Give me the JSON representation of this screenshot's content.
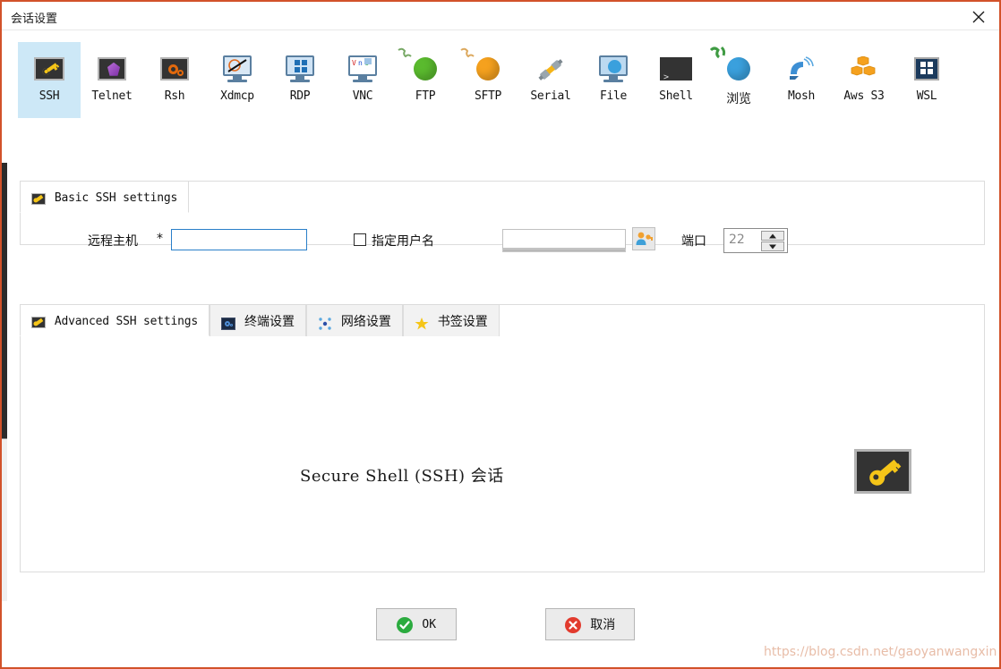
{
  "window": {
    "title": "会话设置",
    "close_icon": "close-icon",
    "accent_color": "#d2522a"
  },
  "protocols": [
    {
      "id": "ssh",
      "label": "SSH",
      "icon": "key-tile-icon",
      "selected": true,
      "cjk": false
    },
    {
      "id": "telnet",
      "label": "Telnet",
      "icon": "purple-gem-icon",
      "selected": false,
      "cjk": false
    },
    {
      "id": "rsh",
      "label": "Rsh",
      "icon": "orange-gears-icon",
      "selected": false,
      "cjk": false
    },
    {
      "id": "xdmcp",
      "label": "Xdmcp",
      "icon": "x-monitor-icon",
      "selected": false,
      "cjk": false
    },
    {
      "id": "rdp",
      "label": "RDP",
      "icon": "windows-monitor-icon",
      "selected": false,
      "cjk": false
    },
    {
      "id": "vnc",
      "label": "VNC",
      "icon": "vnc-monitor-icon",
      "selected": false,
      "cjk": false
    },
    {
      "id": "ftp",
      "label": "FTP",
      "icon": "green-globe-icon",
      "selected": false,
      "cjk": false
    },
    {
      "id": "sftp",
      "label": "SFTP",
      "icon": "orange-globe-icon",
      "selected": false,
      "cjk": false
    },
    {
      "id": "serial",
      "label": "Serial",
      "icon": "serial-connector-icon",
      "selected": false,
      "cjk": false
    },
    {
      "id": "file",
      "label": "File",
      "icon": "globe-monitor-icon",
      "selected": false,
      "cjk": false
    },
    {
      "id": "shell",
      "label": "Shell",
      "icon": "terminal-icon",
      "selected": false,
      "cjk": false
    },
    {
      "id": "browse",
      "label": "浏览",
      "icon": "blue-globe-icon",
      "selected": false,
      "cjk": true
    },
    {
      "id": "mosh",
      "label": "Mosh",
      "icon": "satellite-dish-icon",
      "selected": false,
      "cjk": false
    },
    {
      "id": "awss3",
      "label": "Aws S3",
      "icon": "aws-cubes-icon",
      "selected": false,
      "cjk": false
    },
    {
      "id": "wsl",
      "label": "WSL",
      "icon": "windows-logo-icon",
      "selected": false,
      "cjk": false
    }
  ],
  "basic": {
    "tab_label": "Basic SSH settings",
    "tab_icon": "key-icon",
    "host_label": "远程主机",
    "host_required_mark": "*",
    "host_value": "",
    "host_placeholder": "",
    "specify_user_label": "指定用户名",
    "specify_user_checked": false,
    "user_value": "",
    "user_placeholder": "",
    "user_browse_icon": "user-key-icon",
    "port_label": "端口",
    "port_value": "22",
    "spin_up_icon": "chevron-up-icon",
    "spin_down_icon": "chevron-down-icon"
  },
  "advanced_tabs": [
    {
      "id": "advanced-ssh",
      "label": "Advanced SSH settings",
      "icon": "key-icon",
      "active": true,
      "mono": true
    },
    {
      "id": "terminal",
      "label": "终端设置",
      "icon": "gear-icon",
      "active": false,
      "mono": false
    },
    {
      "id": "network",
      "label": "网络设置",
      "icon": "network-icon",
      "active": false,
      "mono": false
    },
    {
      "id": "bookmark",
      "label": "书签设置",
      "icon": "star-icon",
      "active": false,
      "mono": false
    }
  ],
  "advanced_body": {
    "title": "Secure Shell (SSH) 会话",
    "key_icon": "large-key-icon"
  },
  "footer": {
    "ok_label": "OK",
    "ok_icon": "green-check-icon",
    "cancel_label": "取消",
    "cancel_icon": "red-x-icon"
  },
  "watermark": "https://blog.csdn.net/gaoyanwangxin"
}
